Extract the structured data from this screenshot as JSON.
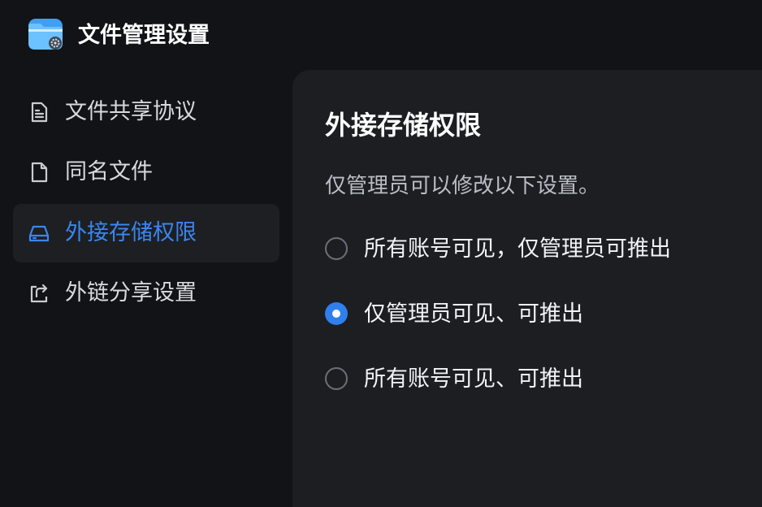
{
  "app": {
    "title": "文件管理设置",
    "icon": "folder-settings-icon",
    "accent_color": "#2f7fee"
  },
  "sidebar": {
    "items": [
      {
        "label": "文件共享协议",
        "icon": "document-lines-icon",
        "active": false
      },
      {
        "label": "同名文件",
        "icon": "document-icon",
        "active": false
      },
      {
        "label": "外接存储权限",
        "icon": "external-drive-icon",
        "active": true
      },
      {
        "label": "外链分享设置",
        "icon": "share-icon",
        "active": false
      }
    ]
  },
  "main": {
    "title": "外接存储权限",
    "description": "仅管理员可以修改以下设置。",
    "options": [
      {
        "label": "所有账号可见，仅管理员可推出",
        "selected": false
      },
      {
        "label": "仅管理员可见、可推出",
        "selected": true
      },
      {
        "label": "所有账号可见、可推出",
        "selected": false
      }
    ]
  }
}
